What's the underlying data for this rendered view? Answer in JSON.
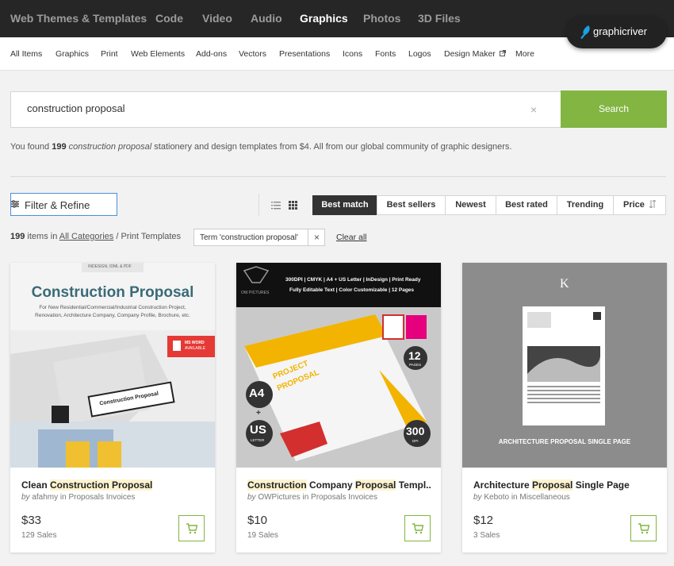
{
  "topnav": {
    "items": [
      "Web Themes & Templates",
      "Code",
      "Video",
      "Audio",
      "Graphics",
      "Photos",
      "3D Files"
    ],
    "active": "Graphics",
    "brand": "graphicriver"
  },
  "subnav": {
    "items": [
      "All Items",
      "Graphics",
      "Print",
      "Web Elements",
      "Add-ons",
      "Vectors",
      "Presentations",
      "Icons",
      "Fonts",
      "Logos",
      "Design Maker",
      "More"
    ]
  },
  "search": {
    "value": "construction proposal",
    "clear": "×",
    "button": "Search"
  },
  "results": {
    "prefix": "You found",
    "count": "199",
    "term": "construction proposal",
    "suffix": "stationery and design templates from $4. All from our global community of graphic designers."
  },
  "filter": {
    "label": "Filter & Refine"
  },
  "sort": {
    "options": [
      "Best match",
      "Best sellers",
      "Newest",
      "Best rated",
      "Trending",
      "Price"
    ],
    "active": "Best match"
  },
  "count_row": {
    "count": "199",
    "items_in": "items in",
    "category_link": "All Categories",
    "path": "/ Print Templates",
    "chip": "Term 'construction proposal'",
    "chip_close": "×",
    "clear_all": "Clear all"
  },
  "cards": [
    {
      "title_parts": [
        "Clean ",
        "Construction Proposal",
        ""
      ],
      "by": "by",
      "author": "afahmy",
      "in": "in Proposals Invoices",
      "price": "$33",
      "sales": "129 Sales",
      "thumb": {
        "tagline": "INDESIGN, IDML & PDF",
        "heading": "Construction Proposal",
        "sub1": "For New Residential/Commercial/Industrial Construction Project,",
        "sub2": "Renovation, Architecture Company, Company Profile, Brochure, etc.",
        "badge1": "MS WORD",
        "badge2": "AVAILABLE",
        "cover": "Construction Proposal"
      }
    },
    {
      "title_parts": [
        "Construction",
        " Company ",
        "Proposal",
        " Templ..."
      ],
      "by": "by",
      "author": "OWPictures",
      "in": "in Proposals Invoices",
      "price": "$10",
      "sales": "19 Sales",
      "thumb": {
        "brand": "OW PICTURES",
        "spec1": "300DPI | CMYK | A4 + US Letter | InDesign | Print Ready",
        "spec2": "Fully Editable Text | Color Customizable | 12 Pages",
        "cover1": "PROJECT",
        "cover2": "PROPOSAL",
        "a4": "A4",
        "plus": "+",
        "us": "US",
        "letter": "LETTER",
        "pages": "12",
        "pages_label": "PAGES",
        "dpi": "300",
        "dpi_label": "DPI"
      }
    },
    {
      "title_parts": [
        "Architecture ",
        "Proposal",
        " Single Page"
      ],
      "by": "by",
      "author": "Keboto",
      "in": "in Miscellaneous",
      "price": "$12",
      "sales": "3 Sales",
      "thumb": {
        "logo": "K",
        "caption": "ARCHITECTURE PROPOSAL SINGLE PAGE"
      }
    }
  ],
  "colors": {
    "accent_green": "#82b541",
    "nav_bg": "#262626",
    "highlight": "#fdf3d0"
  }
}
